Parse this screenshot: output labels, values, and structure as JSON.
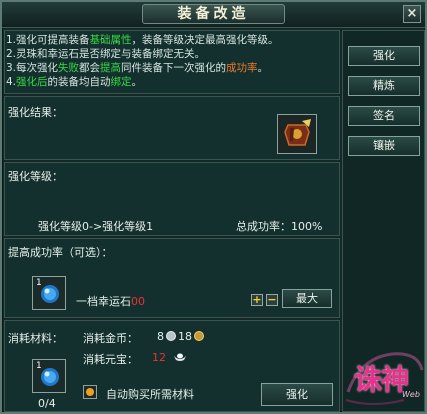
{
  "window": {
    "title": "装备改造",
    "close_label": "×"
  },
  "tips": {
    "line1": {
      "a": "1.强化可提高装备",
      "b": "基础属性",
      "c": "，装备等级决定最高强化等级。"
    },
    "line2": {
      "a": "2.灵珠和幸运石是否绑定与装备绑定无关。"
    },
    "line3": {
      "a": "3.每次强化",
      "b": "失败",
      "c": "都会",
      "d": "提高",
      "e": "同件装备下一次强化的",
      "f": "成功率",
      "g": "。"
    },
    "line4": {
      "a": "4.",
      "b": "强化后",
      "c": "的装备均自动",
      "d": "绑定",
      "e": "。"
    }
  },
  "side_menu": [
    "强化",
    "精炼",
    "签名",
    "镶嵌"
  ],
  "result": {
    "label": "强化结果："
  },
  "level": {
    "label": "强化等级：",
    "change": "强化等级0->强化等级1",
    "total_rate": "总成功率：100%"
  },
  "boost": {
    "label": "提高成功率（可选）：",
    "slot_count": "1",
    "item_name": "一档幸运石",
    "item_qty": "00",
    "plus": "+",
    "minus": "−",
    "max_label": "最大"
  },
  "materials": {
    "label": "消耗材料：",
    "gold_label": "消耗金币：",
    "gold_a": "8",
    "gold_b": "18",
    "yuanbao_label": "消耗元宝：",
    "yuanbao_value": "12",
    "slot_count": "1",
    "stock": "0/4",
    "auto_buy_label": "自动购买所需材料",
    "confirm_label": "强化"
  },
  "logo": {
    "text": "诛神",
    "sub": "Web"
  },
  "colors": {
    "green": "#3ad846",
    "orange": "#f07828",
    "red": "#f03030",
    "yellow": "#f0d23a",
    "teal_panel": "#13302e",
    "logo_pink": "#e8308c"
  }
}
